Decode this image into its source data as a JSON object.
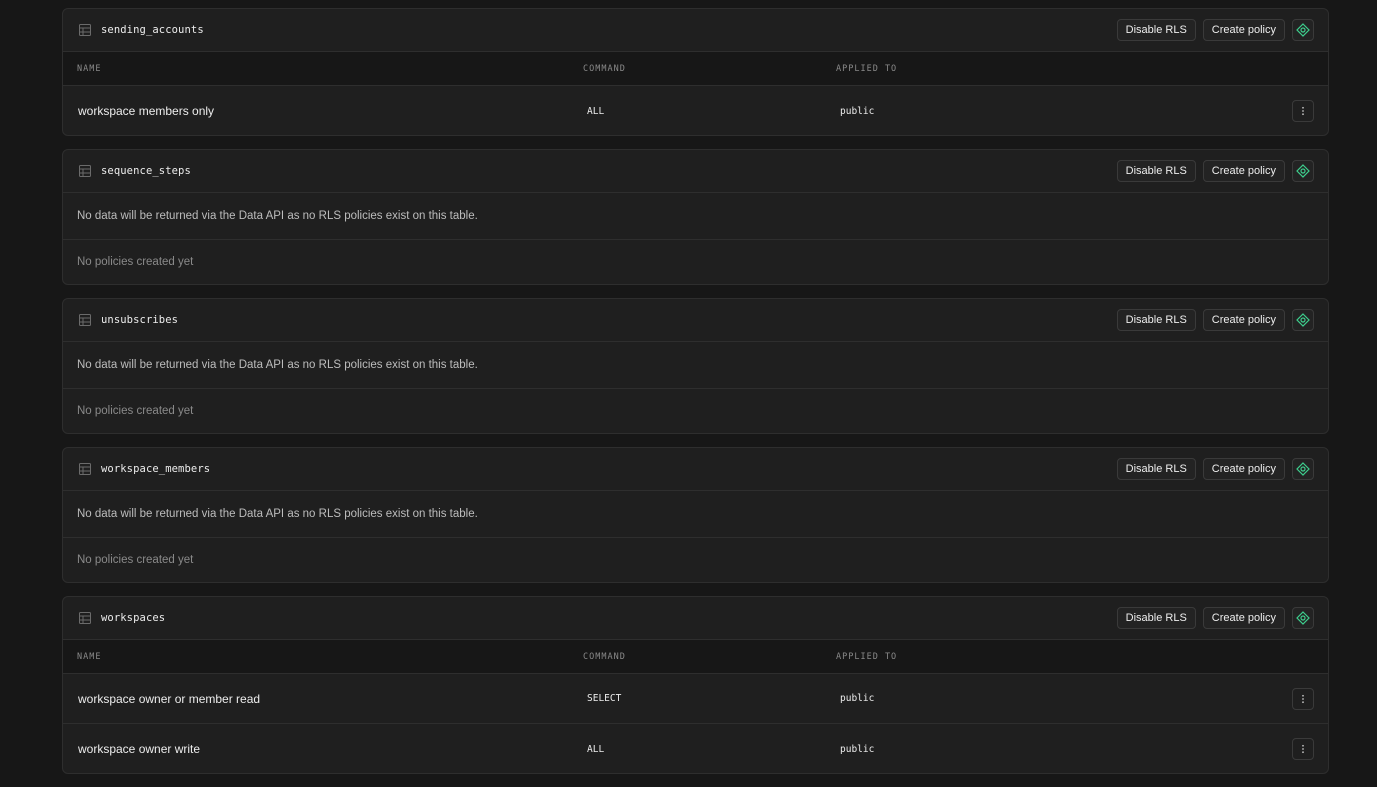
{
  "buttons": {
    "disable_rls": "Disable RLS",
    "create_policy": "Create policy"
  },
  "columns": {
    "name": "NAME",
    "command": "COMMAND",
    "applied_to": "APPLIED TO"
  },
  "messages": {
    "no_rls": "No data will be returned via the Data API as no RLS policies exist on this table.",
    "no_policies": "No policies created yet"
  },
  "tables": [
    {
      "name": "sending_accounts",
      "policies": [
        {
          "name": "workspace members only",
          "command": "ALL",
          "applied_to": "public"
        }
      ]
    },
    {
      "name": "sequence_steps",
      "policies": []
    },
    {
      "name": "unsubscribes",
      "policies": []
    },
    {
      "name": "workspace_members",
      "policies": []
    },
    {
      "name": "workspaces",
      "policies": [
        {
          "name": "workspace owner or member read",
          "command": "SELECT",
          "applied_to": "public"
        },
        {
          "name": "workspace owner write",
          "command": "ALL",
          "applied_to": "public"
        }
      ]
    }
  ],
  "colors": {
    "accent": "#3ecf8e",
    "background": "#171717",
    "card": "#1f1f1f",
    "border": "#2e2e2e"
  },
  "icons": {
    "table": "table-icon",
    "policy_check": "shield-check-icon",
    "more": "more-vertical-icon"
  }
}
